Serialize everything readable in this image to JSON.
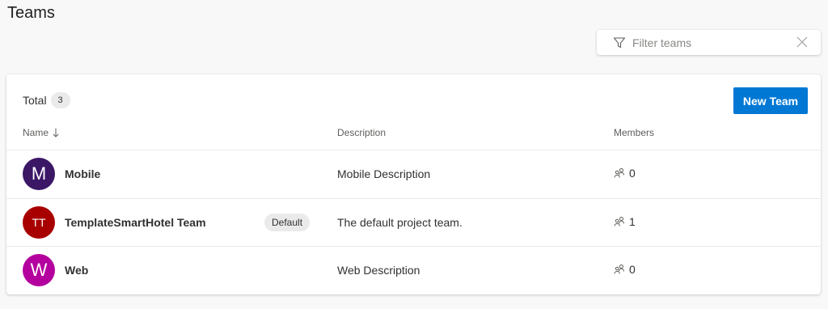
{
  "page": {
    "title": "Teams"
  },
  "filter": {
    "placeholder": "Filter teams",
    "icon": "funnel-icon",
    "clear_icon": "close-icon"
  },
  "summary": {
    "total_label": "Total",
    "total_count": "3"
  },
  "actions": {
    "new_team_label": "New Team"
  },
  "columns": {
    "name": "Name",
    "description": "Description",
    "members": "Members"
  },
  "teams": [
    {
      "initials": "M",
      "name": "Mobile",
      "badge": "",
      "description": "Mobile Description",
      "members": "0",
      "color": "#3b1766"
    },
    {
      "initials": "TT",
      "name": "TemplateSmartHotel Team",
      "badge": "Default",
      "description": "The default project team.",
      "members": "1",
      "color": "#a80000"
    },
    {
      "initials": "W",
      "name": "Web",
      "badge": "",
      "description": "Web Description",
      "members": "0",
      "color": "#b4009e"
    }
  ],
  "colors": {
    "accent": "#0078d4",
    "background": "#f8f8f8"
  }
}
